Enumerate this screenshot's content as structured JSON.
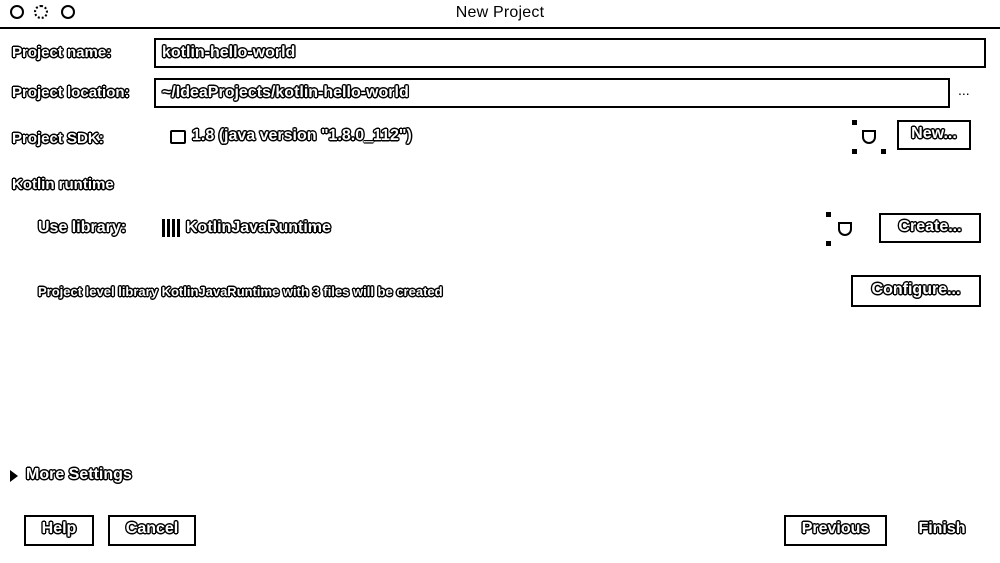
{
  "window": {
    "title": "New Project"
  },
  "form": {
    "project_name_label": "Project name:",
    "project_name_value": "kotlin-hello-world",
    "project_location_label": "Project location:",
    "project_location_value": "~/IdeaProjects/kotlin-hello-world",
    "browse_label": "...",
    "project_sdk_label": "Project SDK:",
    "project_sdk_value": "1.8 (java version \"1.8.0_112\")",
    "new_button": "New...",
    "kotlin_runtime_label": "Kotlin runtime",
    "use_library_label": "Use library:",
    "use_library_value": "KotlinJavaRuntime",
    "create_button": "Create...",
    "library_note": "Project level library KotlinJavaRuntime with 3 files will be created",
    "configure_button": "Configure..."
  },
  "more_settings": {
    "label": "More Settings"
  },
  "footer": {
    "help_button": "Help",
    "cancel_button": "Cancel",
    "previous_button": "Previous",
    "finish_button": "Finish"
  }
}
